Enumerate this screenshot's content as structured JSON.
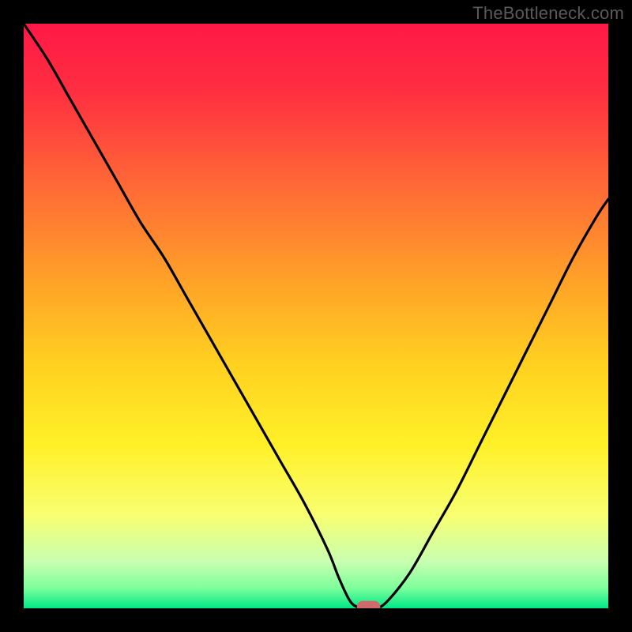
{
  "watermark": "TheBottleneck.com",
  "gradient_stops": [
    {
      "offset": 0.0,
      "color": "#ff1846"
    },
    {
      "offset": 0.12,
      "color": "#ff3040"
    },
    {
      "offset": 0.28,
      "color": "#ff6a36"
    },
    {
      "offset": 0.44,
      "color": "#ffa228"
    },
    {
      "offset": 0.58,
      "color": "#ffd020"
    },
    {
      "offset": 0.72,
      "color": "#fff028"
    },
    {
      "offset": 0.84,
      "color": "#f8ff70"
    },
    {
      "offset": 0.92,
      "color": "#c8ffb0"
    },
    {
      "offset": 0.965,
      "color": "#7eff9a"
    },
    {
      "offset": 1.0,
      "color": "#00e888"
    }
  ],
  "chart_data": {
    "type": "line",
    "title": "",
    "xlabel": "",
    "ylabel": "",
    "xlim": [
      0,
      100
    ],
    "ylim": [
      0,
      100
    ],
    "grid": false,
    "legend": false,
    "x": [
      0,
      4,
      8,
      12,
      16,
      20,
      24,
      28,
      32,
      36,
      40,
      44,
      48,
      52,
      54,
      56,
      58,
      60,
      62,
      66,
      70,
      74,
      78,
      82,
      86,
      90,
      94,
      98,
      100
    ],
    "values": [
      100,
      94,
      87,
      80,
      73,
      66,
      60,
      53,
      46,
      39,
      32,
      25,
      18,
      10,
      5,
      1,
      0,
      0,
      1,
      6,
      13,
      20,
      28,
      36,
      44,
      52,
      60,
      67,
      70
    ],
    "minimum_marker": {
      "x": 59,
      "y": 0,
      "width": 4,
      "height": 2
    },
    "annotations": [
      {
        "text": "TheBottleneck.com",
        "position": "top-right"
      }
    ]
  }
}
